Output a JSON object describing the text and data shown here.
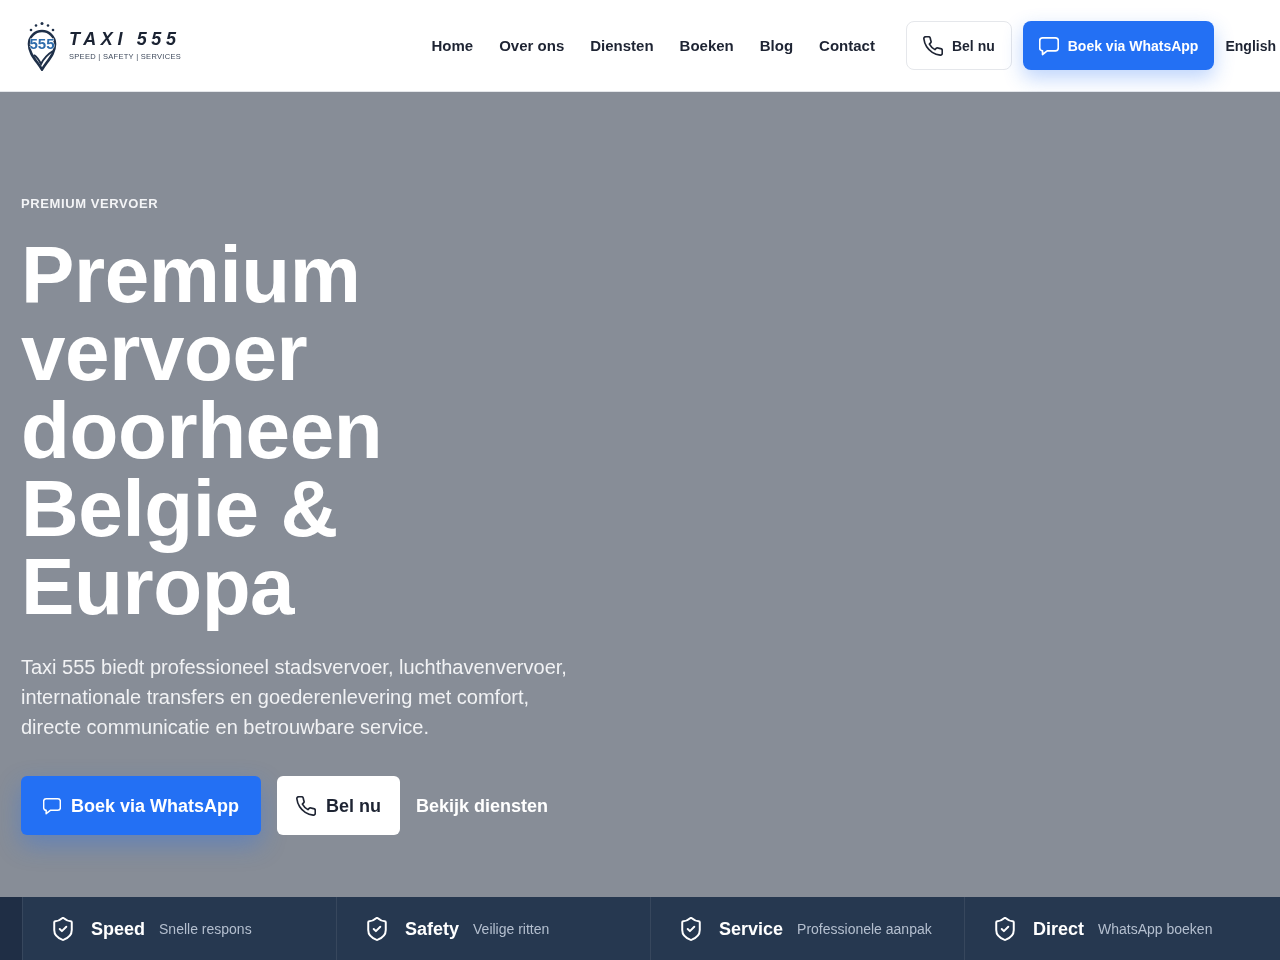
{
  "header": {
    "logo": {
      "emblem_text": "555",
      "title": "TAXI 555",
      "tagline": "SPEED | SAFETY | SERVICES"
    },
    "nav": [
      {
        "label": "Home"
      },
      {
        "label": "Over ons"
      },
      {
        "label": "Diensten"
      },
      {
        "label": "Boeken"
      },
      {
        "label": "Blog"
      },
      {
        "label": "Contact"
      }
    ],
    "actions": [
      {
        "kind": "call",
        "label": "Bel nu"
      },
      {
        "kind": "whatsapp",
        "label": "Boek via WhatsApp"
      }
    ],
    "language": "English"
  },
  "hero": {
    "eyebrow": "PREMIUM VERVOER",
    "title": "Premium vervoer doorheen Belgie & Europa",
    "description": "Taxi 555 biedt professioneel stadsvervoer, luchthavenvervoer, internationale transfers en goederenlevering met comfort, directe communicatie en betrouwbare service.",
    "buttons": [
      {
        "kind": "whatsapp",
        "label": "Boek via WhatsApp"
      },
      {
        "kind": "call",
        "label": "Bel nu"
      },
      {
        "kind": "link",
        "label": "Bekijk diensten"
      }
    ]
  },
  "features": [
    {
      "title": "Speed",
      "subtitle": "Snelle respons"
    },
    {
      "title": "Safety",
      "subtitle": "Veilige ritten"
    },
    {
      "title": "Service",
      "subtitle": "Professionele aanpak"
    },
    {
      "title": "Direct",
      "subtitle": "WhatsApp boeken"
    }
  ]
}
